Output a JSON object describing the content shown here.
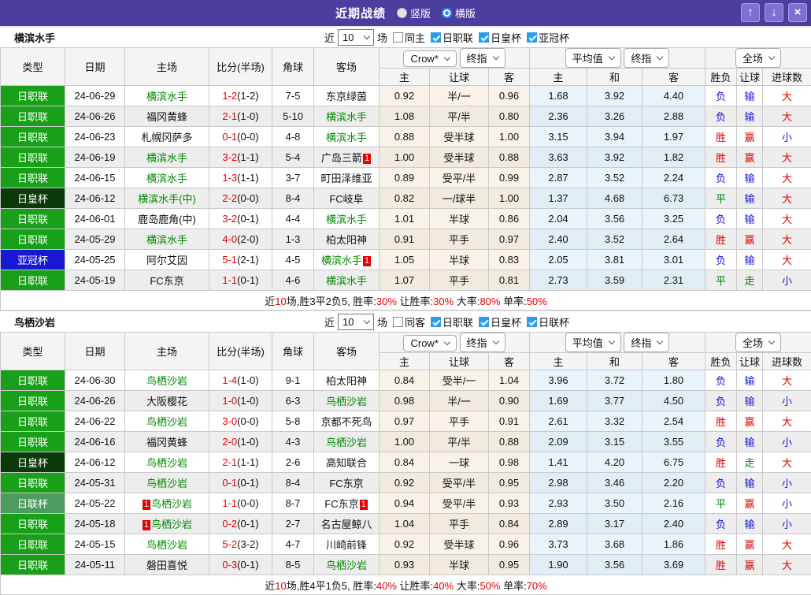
{
  "topbar": {
    "title": "近期战绩",
    "radios": [
      {
        "label": "竖版",
        "selected": false
      },
      {
        "label": "横版",
        "selected": true
      }
    ],
    "buttons": {
      "up": "↑",
      "down": "↓",
      "close": "×"
    }
  },
  "header": {
    "cols": [
      "类型",
      "日期",
      "主场",
      "比分(半场)",
      "角球",
      "客场"
    ],
    "crow_dropdown": "Crow*",
    "final_dropdown": "终指",
    "avg_dropdown": "平均值",
    "final_dropdown2": "终指",
    "full_dropdown": "全场",
    "crow_cols": [
      "主",
      "让球",
      "客"
    ],
    "avg_cols": [
      "主",
      "和",
      "客"
    ],
    "full_cols": [
      "胜负",
      "让球",
      "进球数"
    ]
  },
  "colors": {
    "league": {
      "日职联": "#18a118",
      "日皇杯": "#0a3a0a",
      "亚冠杯": "#1717d4",
      "日联杯": "#4d9b5f"
    },
    "result": {
      "胜": "#e60000",
      "负": "#1515dd",
      "平": "#008000",
      "赢": "#e60000",
      "输": "#1515dd",
      "走": "#008000",
      "大": "#e60000",
      "小": "#1515dd"
    },
    "accent_purple": "#4b3e9f",
    "focus_team_green": "#008800",
    "score_red": "#e60000",
    "checkbox_blue": "#2b9df0"
  },
  "sections": [
    {
      "team": "横滨水手",
      "filter": {
        "prefix": "近",
        "matches": "10",
        "suffix": "场",
        "checkboxes": [
          {
            "label": "同主",
            "checked": false
          },
          {
            "label": "日职联",
            "checked": true
          },
          {
            "label": "日皇杯",
            "checked": true
          },
          {
            "label": "亚冠杯",
            "checked": true
          }
        ]
      },
      "rows": [
        {
          "league": "日职联",
          "date": "24-06-29",
          "home": {
            "name": "横滨水手",
            "focus": true
          },
          "score": "1-2",
          "half": "(1-2)",
          "corner": "7-5",
          "away": {
            "name": "东京绿茵"
          },
          "crow": [
            "0.92",
            "半/一",
            "0.96"
          ],
          "avg": [
            "1.68",
            "3.92",
            "4.40"
          ],
          "result": [
            "负",
            "输",
            "大"
          ]
        },
        {
          "league": "日职联",
          "date": "24-06-26",
          "home": {
            "name": "福冈黄蜂"
          },
          "score": "2-1",
          "half": "(1-0)",
          "corner": "5-10",
          "away": {
            "name": "横滨水手",
            "focus": true
          },
          "crow": [
            "1.08",
            "平/半",
            "0.80"
          ],
          "avg": [
            "2.36",
            "3.26",
            "2.88"
          ],
          "result": [
            "负",
            "输",
            "大"
          ]
        },
        {
          "league": "日职联",
          "date": "24-06-23",
          "home": {
            "name": "札幌冈萨多"
          },
          "score": "0-1",
          "half": "(0-0)",
          "corner": "4-8",
          "away": {
            "name": "横滨水手",
            "focus": true
          },
          "crow": [
            "0.88",
            "受半球",
            "1.00"
          ],
          "avg": [
            "3.15",
            "3.94",
            "1.97"
          ],
          "result": [
            "胜",
            "赢",
            "小"
          ]
        },
        {
          "league": "日职联",
          "date": "24-06-19",
          "home": {
            "name": "横滨水手",
            "focus": true
          },
          "score": "3-2",
          "half": "(1-1)",
          "corner": "5-4",
          "away": {
            "name": "广岛三箭",
            "badge": "1"
          },
          "crow": [
            "1.00",
            "受半球",
            "0.88"
          ],
          "avg": [
            "3.63",
            "3.92",
            "1.82"
          ],
          "result": [
            "胜",
            "赢",
            "大"
          ]
        },
        {
          "league": "日职联",
          "date": "24-06-15",
          "home": {
            "name": "横滨水手",
            "focus": true
          },
          "score": "1-3",
          "half": "(1-1)",
          "corner": "3-7",
          "away": {
            "name": "町田泽维亚"
          },
          "crow": [
            "0.89",
            "受平/半",
            "0.99"
          ],
          "avg": [
            "2.87",
            "3.52",
            "2.24"
          ],
          "result": [
            "负",
            "输",
            "大"
          ]
        },
        {
          "league": "日皇杯",
          "date": "24-06-12",
          "home": {
            "name": "横滨水手(中)",
            "focus": true
          },
          "score": "2-2",
          "half": "(0-0)",
          "corner": "8-4",
          "away": {
            "name": "FC岐阜"
          },
          "crow": [
            "0.82",
            "一/球半",
            "1.00"
          ],
          "avg": [
            "1.37",
            "4.68",
            "6.73"
          ],
          "result": [
            "平",
            "输",
            "大"
          ]
        },
        {
          "league": "日职联",
          "date": "24-06-01",
          "home": {
            "name": "鹿岛鹿角(中)"
          },
          "score": "3-2",
          "half": "(0-1)",
          "corner": "4-4",
          "away": {
            "name": "横滨水手",
            "focus": true
          },
          "crow": [
            "1.01",
            "半球",
            "0.86"
          ],
          "avg": [
            "2.04",
            "3.56",
            "3.25"
          ],
          "result": [
            "负",
            "输",
            "大"
          ]
        },
        {
          "league": "日职联",
          "date": "24-05-29",
          "home": {
            "name": "横滨水手",
            "focus": true
          },
          "score": "4-0",
          "half": "(2-0)",
          "corner": "1-3",
          "away": {
            "name": "柏太阳神"
          },
          "crow": [
            "0.91",
            "平手",
            "0.97"
          ],
          "avg": [
            "2.40",
            "3.52",
            "2.64"
          ],
          "result": [
            "胜",
            "赢",
            "大"
          ]
        },
        {
          "league": "亚冠杯",
          "date": "24-05-25",
          "home": {
            "name": "阿尔艾因"
          },
          "score": "5-1",
          "half": "(2-1)",
          "corner": "4-5",
          "away": {
            "name": "横滨水手",
            "focus": true,
            "badge": "1"
          },
          "crow": [
            "1.05",
            "半球",
            "0.83"
          ],
          "avg": [
            "2.05",
            "3.81",
            "3.01"
          ],
          "result": [
            "负",
            "输",
            "大"
          ]
        },
        {
          "league": "日职联",
          "date": "24-05-19",
          "home": {
            "name": "FC东京"
          },
          "score": "1-1",
          "half": "(0-1)",
          "corner": "4-6",
          "away": {
            "name": "横滨水手",
            "focus": true
          },
          "crow": [
            "1.07",
            "平手",
            "0.81"
          ],
          "avg": [
            "2.73",
            "3.59",
            "2.31"
          ],
          "result": [
            "平",
            "走",
            "小"
          ]
        }
      ],
      "summary": [
        {
          "t": "近"
        },
        {
          "t": "10",
          "red": true
        },
        {
          "t": "场,胜3平2负5, 胜率:"
        },
        {
          "t": "30%",
          "red": true
        },
        {
          "t": " 让胜率:"
        },
        {
          "t": "30%",
          "red": true
        },
        {
          "t": " 大率:"
        },
        {
          "t": "80%",
          "red": true
        },
        {
          "t": " 单率:"
        },
        {
          "t": "50%",
          "red": true
        }
      ]
    },
    {
      "team": "鸟栖沙岩",
      "filter": {
        "prefix": "近",
        "matches": "10",
        "suffix": "场",
        "checkboxes": [
          {
            "label": "同客",
            "checked": false
          },
          {
            "label": "日职联",
            "checked": true
          },
          {
            "label": "日皇杯",
            "checked": true
          },
          {
            "label": "日联杯",
            "checked": true
          }
        ]
      },
      "rows": [
        {
          "league": "日职联",
          "date": "24-06-30",
          "home": {
            "name": "鸟栖沙岩",
            "focus": true
          },
          "score": "1-4",
          "half": "(1-0)",
          "corner": "9-1",
          "away": {
            "name": "柏太阳神"
          },
          "crow": [
            "0.84",
            "受半/一",
            "1.04"
          ],
          "avg": [
            "3.96",
            "3.72",
            "1.80"
          ],
          "result": [
            "负",
            "输",
            "大"
          ]
        },
        {
          "league": "日职联",
          "date": "24-06-26",
          "home": {
            "name": "大阪樱花"
          },
          "score": "1-0",
          "half": "(1-0)",
          "corner": "6-3",
          "away": {
            "name": "鸟栖沙岩",
            "focus": true
          },
          "crow": [
            "0.98",
            "半/一",
            "0.90"
          ],
          "avg": [
            "1.69",
            "3.77",
            "4.50"
          ],
          "result": [
            "负",
            "输",
            "小"
          ]
        },
        {
          "league": "日职联",
          "date": "24-06-22",
          "home": {
            "name": "鸟栖沙岩",
            "focus": true
          },
          "score": "3-0",
          "half": "(0-0)",
          "corner": "5-8",
          "away": {
            "name": "京都不死鸟"
          },
          "crow": [
            "0.97",
            "平手",
            "0.91"
          ],
          "avg": [
            "2.61",
            "3.32",
            "2.54"
          ],
          "result": [
            "胜",
            "赢",
            "大"
          ]
        },
        {
          "league": "日职联",
          "date": "24-06-16",
          "home": {
            "name": "福冈黄蜂"
          },
          "score": "2-0",
          "half": "(1-0)",
          "corner": "4-3",
          "away": {
            "name": "鸟栖沙岩",
            "focus": true
          },
          "crow": [
            "1.00",
            "平/半",
            "0.88"
          ],
          "avg": [
            "2.09",
            "3.15",
            "3.55"
          ],
          "result": [
            "负",
            "输",
            "小"
          ]
        },
        {
          "league": "日皇杯",
          "date": "24-06-12",
          "home": {
            "name": "鸟栖沙岩",
            "focus": true
          },
          "score": "2-1",
          "half": "(1-1)",
          "corner": "2-6",
          "away": {
            "name": "高知联合"
          },
          "crow": [
            "0.84",
            "一球",
            "0.98"
          ],
          "avg": [
            "1.41",
            "4.20",
            "6.75"
          ],
          "result": [
            "胜",
            "走",
            "大"
          ]
        },
        {
          "league": "日职联",
          "date": "24-05-31",
          "home": {
            "name": "鸟栖沙岩",
            "focus": true
          },
          "score": "0-1",
          "half": "(0-1)",
          "corner": "8-4",
          "away": {
            "name": "FC东京"
          },
          "crow": [
            "0.92",
            "受平/半",
            "0.95"
          ],
          "avg": [
            "2.98",
            "3.46",
            "2.20"
          ],
          "result": [
            "负",
            "输",
            "小"
          ]
        },
        {
          "league": "日联杯",
          "date": "24-05-22",
          "home": {
            "name": "鸟栖沙岩",
            "focus": true,
            "badge": "1"
          },
          "score": "1-1",
          "half": "(0-0)",
          "corner": "8-7",
          "away": {
            "name": "FC东京",
            "badge": "1"
          },
          "crow": [
            "0.94",
            "受平/半",
            "0.93"
          ],
          "avg": [
            "2.93",
            "3.50",
            "2.16"
          ],
          "result": [
            "平",
            "赢",
            "小"
          ]
        },
        {
          "league": "日职联",
          "date": "24-05-18",
          "home": {
            "name": "鸟栖沙岩",
            "focus": true,
            "badge": "1"
          },
          "score": "0-2",
          "half": "(0-1)",
          "corner": "2-7",
          "away": {
            "name": "名古屋鲸八"
          },
          "crow": [
            "1.04",
            "平手",
            "0.84"
          ],
          "avg": [
            "2.89",
            "3.17",
            "2.40"
          ],
          "result": [
            "负",
            "输",
            "小"
          ]
        },
        {
          "league": "日职联",
          "date": "24-05-15",
          "home": {
            "name": "鸟栖沙岩",
            "focus": true
          },
          "score": "5-2",
          "half": "(3-2)",
          "corner": "4-7",
          "away": {
            "name": "川崎前锋"
          },
          "crow": [
            "0.92",
            "受半球",
            "0.96"
          ],
          "avg": [
            "3.73",
            "3.68",
            "1.86"
          ],
          "result": [
            "胜",
            "赢",
            "大"
          ]
        },
        {
          "league": "日职联",
          "date": "24-05-11",
          "home": {
            "name": "磐田喜悦"
          },
          "score": "0-3",
          "half": "(0-1)",
          "corner": "8-5",
          "away": {
            "name": "鸟栖沙岩",
            "focus": true
          },
          "crow": [
            "0.93",
            "半球",
            "0.95"
          ],
          "avg": [
            "1.90",
            "3.56",
            "3.69"
          ],
          "result": [
            "胜",
            "赢",
            "大"
          ]
        }
      ],
      "summary": [
        {
          "t": "近"
        },
        {
          "t": "10",
          "red": true
        },
        {
          "t": "场,胜4平1负5, 胜率:"
        },
        {
          "t": "40%",
          "red": true
        },
        {
          "t": " 让胜率:"
        },
        {
          "t": "40%",
          "red": true
        },
        {
          "t": " 大率:"
        },
        {
          "t": "50%",
          "red": true
        },
        {
          "t": " 单率:"
        },
        {
          "t": "70%",
          "red": true
        }
      ]
    }
  ]
}
